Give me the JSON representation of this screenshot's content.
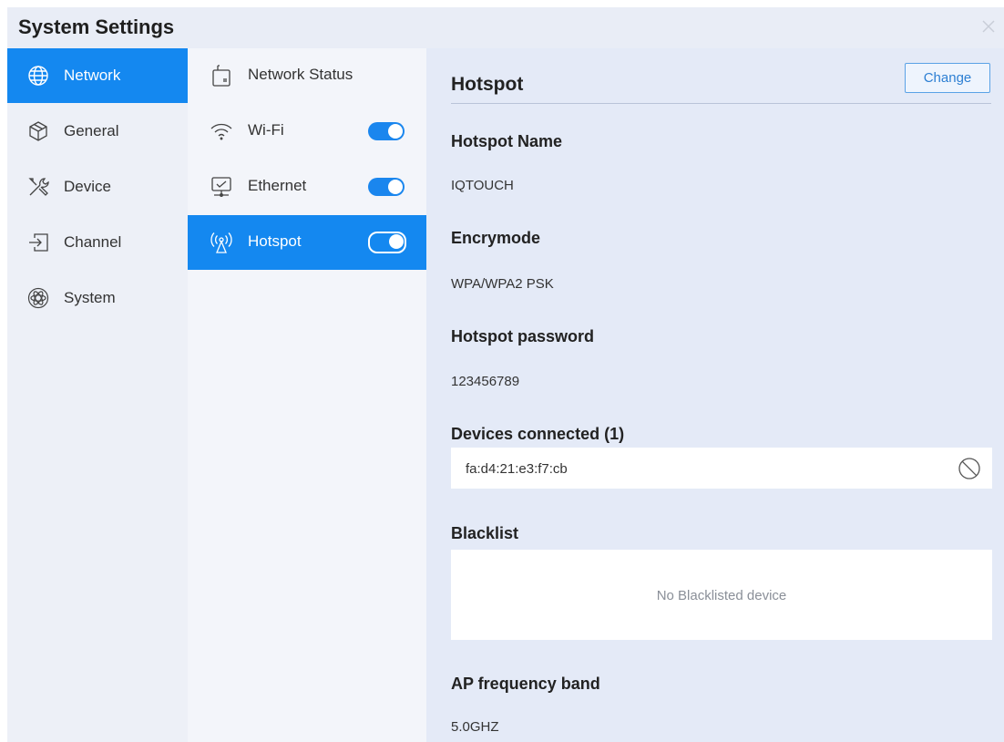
{
  "window": {
    "title": "System Settings",
    "close_icon": "close-icon"
  },
  "categories": [
    {
      "label": "Network",
      "icon": "globe-icon",
      "active": true
    },
    {
      "label": "General",
      "icon": "cube-icon",
      "active": false
    },
    {
      "label": "Device",
      "icon": "tools-icon",
      "active": false
    },
    {
      "label": "Channel",
      "icon": "input-icon",
      "active": false
    },
    {
      "label": "System",
      "icon": "atom-icon",
      "active": false
    }
  ],
  "subnav": [
    {
      "label": "Network Status",
      "icon": "router-icon",
      "toggle": null,
      "active": false
    },
    {
      "label": "Wi-Fi",
      "icon": "wifi-icon",
      "toggle": true,
      "active": false
    },
    {
      "label": "Ethernet",
      "icon": "ethernet-icon",
      "toggle": true,
      "active": false
    },
    {
      "label": "Hotspot",
      "icon": "hotspot-icon",
      "toggle": true,
      "active": true
    }
  ],
  "hotspot": {
    "title": "Hotspot",
    "change_label": "Change",
    "name_label": "Hotspot Name",
    "name_value": "IQTOUCH",
    "encrymode_label": "Encrymode",
    "encrymode_value": "WPA/WPA2 PSK",
    "password_label": "Hotspot password",
    "password_value": "123456789",
    "devices_label": "Devices connected (1)",
    "devices": [
      {
        "mac": "fa:d4:21:e3:f7:cb"
      }
    ],
    "blacklist_label": "Blacklist",
    "blacklist_empty": "No Blacklisted device",
    "band_label": "AP frequency band",
    "band_value": "5.0GHZ"
  },
  "colors": {
    "accent": "#1488f0",
    "toggle": "#1a86ee",
    "panel_bg": "#e4eaf7"
  }
}
